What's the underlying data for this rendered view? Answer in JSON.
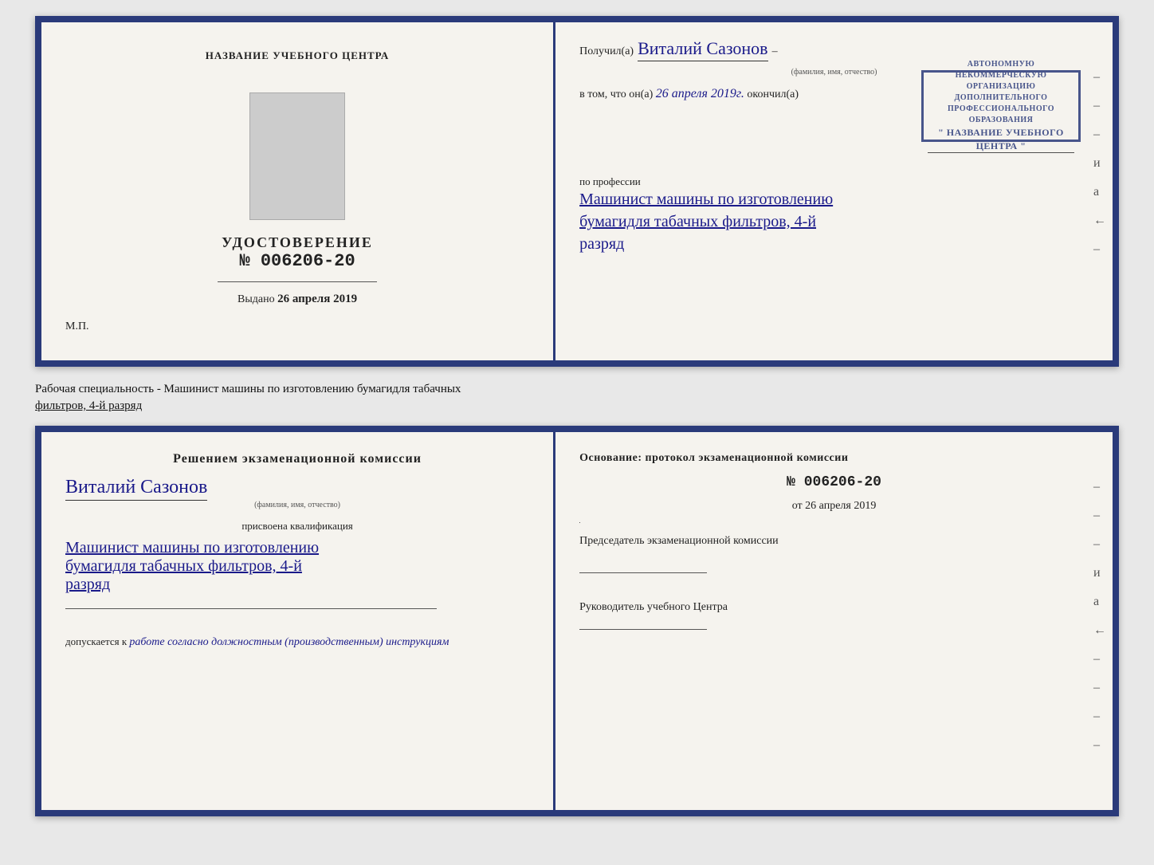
{
  "topCert": {
    "left": {
      "title": "НАЗВАНИЕ УЧЕБНОГО ЦЕНТРА",
      "certLabel": "УДОСТОВЕРЕНИЕ",
      "certNumber": "№ 006206-20",
      "issuedLabel": "Выдано",
      "issuedDate": "26 апреля 2019",
      "mpLabel": "М.П."
    },
    "right": {
      "receivedLabel": "Получил(а)",
      "recipientName": "Виталий Сазонов",
      "recipientNameSubLabel": "(фамилия, имя, отчество)",
      "vtomLabel": "в том, что он(а)",
      "completedDate": "26 апреля 2019г.",
      "completedLabel": "окончил(а)",
      "orgLine1": "АВТОНОМНУЮ НЕКОММЕРЧЕСКУЮ ОРГАНИЗАЦИЮ",
      "orgLine2": "ДОПОЛНИТЕЛЬНОГО ПРОФЕССИОНАЛЬНОГО ОБРАЗОВАНИЯ",
      "orgName": "\" НАЗВАНИЕ УЧЕБНОГО ЦЕНТРА \"",
      "professionLabel": "по профессии",
      "professionLine1": "Машинист машины по изготовлению",
      "professionLine2": "бумагидля табачных фильтров, 4-й",
      "professionLine3": "разряд"
    }
  },
  "separatorText": {
    "line1": "Рабочая специальность - Машинист машины по изготовлению бумагидля табачных",
    "line2underline": "фильтров, 4-й разряд"
  },
  "bottomCert": {
    "left": {
      "commissionTitle": "Решением экзаменационной комиссии",
      "personName": "Виталий Сазонов",
      "personNameSubLabel": "(фамилия, имя, отчество)",
      "assignedLabel": "присвоена квалификация",
      "qualLine1": "Машинист машины по изготовлению",
      "qualLine2": "бумагидля табачных фильтров, 4-й",
      "qualLine3": "разряд",
      "allowedLabel": "допускается к",
      "allowedValue": "работе согласно должностным (производственным) инструкциям"
    },
    "right": {
      "basisLabel": "Основание: протокол экзаменационной комиссии",
      "protocolNumber": "№ 006206-20",
      "protocolDatePrefix": "от",
      "protocolDate": "26 апреля 2019",
      "chairmanLabel": "Председатель экзаменационной комиссии",
      "headLabel": "Руководитель учебного Центра"
    }
  },
  "decorative": {
    "dashes": [
      "-",
      "-",
      "-",
      "и",
      "а",
      "←",
      "-",
      "-",
      "-",
      "-",
      "-",
      "-",
      "-"
    ]
  }
}
